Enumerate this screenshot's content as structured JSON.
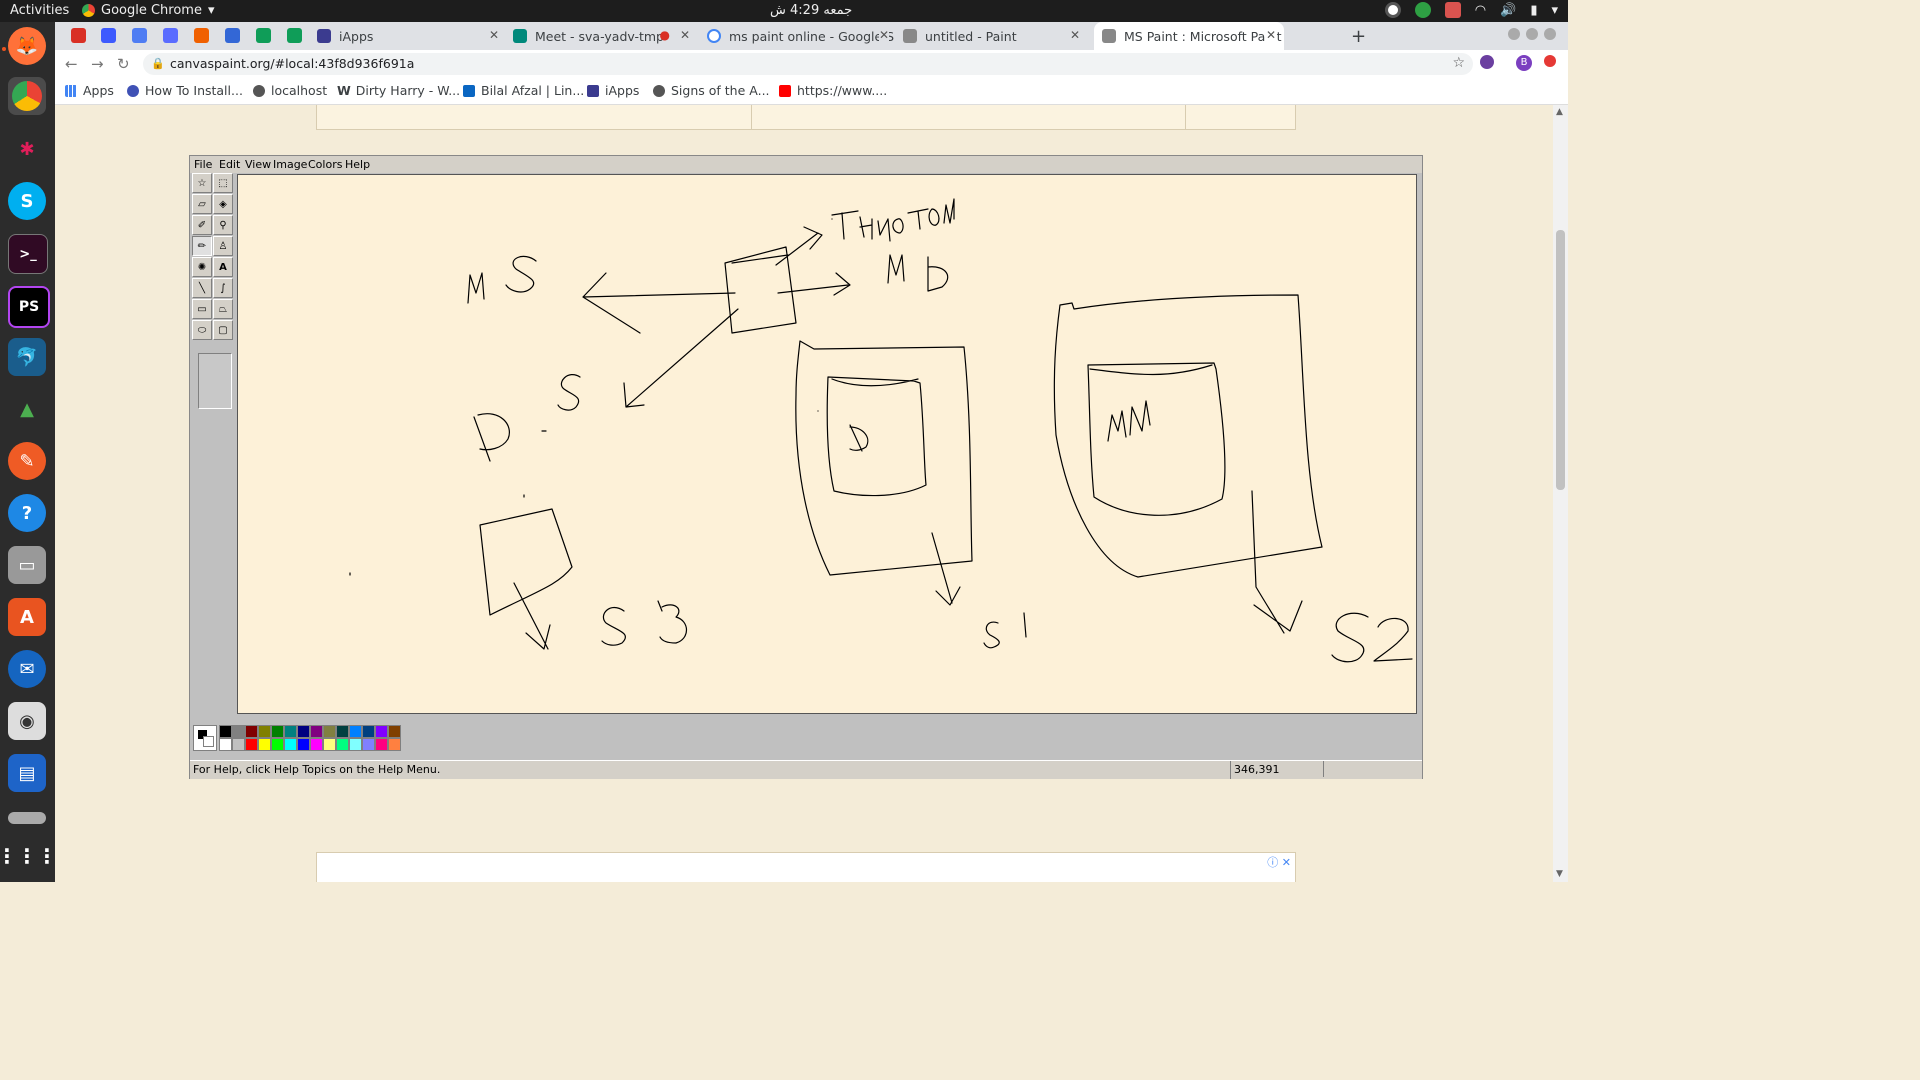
{
  "os": {
    "activities": "Activities",
    "app_name": "Google Chrome",
    "clock": "جمعه 4:29 ش"
  },
  "browser": {
    "tabs": [
      {
        "label": "iApps",
        "active": false
      },
      {
        "label": "Meet - sva-yadv-tmp",
        "active": false
      },
      {
        "label": "ms paint online - Google S",
        "active": false
      },
      {
        "label": "untitled - Paint",
        "active": false
      },
      {
        "label": "MS Paint : Microsoft Paint",
        "active": true
      }
    ],
    "url": "canvaspaint.org/#local:43f8d936f691a",
    "profile_initial": "B",
    "bookmarks": [
      {
        "label": "Apps"
      },
      {
        "label": "How To Install..."
      },
      {
        "label": "localhost"
      },
      {
        "label": "Dirty Harry - W..."
      },
      {
        "label": "Bilal Afzal | Lin..."
      },
      {
        "label": "iApps"
      },
      {
        "label": "Signs of the A..."
      },
      {
        "label": "https://www...."
      }
    ]
  },
  "paint": {
    "menus": [
      "File",
      "Edit",
      "View",
      "Image",
      "Colors",
      "Help"
    ],
    "status_help": "For Help, click Help Topics on the Help Menu.",
    "coords": "346,391",
    "palette": [
      "#000000",
      "#808080",
      "#800000",
      "#808000",
      "#008000",
      "#008080",
      "#000080",
      "#800080",
      "#808040",
      "#004040",
      "#0080ff",
      "#004080",
      "#8000ff",
      "#804000",
      "#ffffff",
      "#c0c0c0",
      "#ff0000",
      "#ffff00",
      "#00ff00",
      "#00ffff",
      "#0000ff",
      "#ff00ff",
      "#ffff80",
      "#00ff80",
      "#80ffff",
      "#8080ff",
      "#ff0080",
      "#ff8040"
    ],
    "drawing_labels": [
      "MS",
      "Third Pari",
      "MD",
      "D",
      "S",
      "D",
      "MN",
      "S3",
      "S1",
      "S2"
    ]
  }
}
